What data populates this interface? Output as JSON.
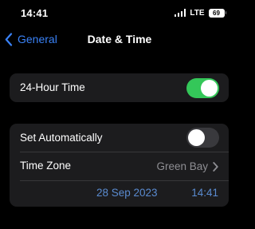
{
  "status_bar": {
    "time": "14:41",
    "network": "LTE",
    "battery_level": "69",
    "icons": [
      "signal-icon",
      "battery-icon"
    ]
  },
  "nav": {
    "back_label": "General",
    "title": "Date & Time",
    "back_icon": "chevron-left-icon"
  },
  "colors": {
    "accent": "#3a82f7",
    "toggle_on": "#34c759",
    "toggle_off": "#39393d",
    "group_bg": "#1c1c1e",
    "secondary_text": "#8e8e93",
    "date_time_text": "#5a8bd0"
  },
  "settings": {
    "hour24": {
      "label": "24-Hour Time",
      "enabled": true
    },
    "set_automatically": {
      "label": "Set Automatically",
      "enabled": false
    },
    "time_zone": {
      "label": "Time Zone",
      "value": "Green Bay",
      "icon": "chevron-right-icon"
    },
    "date": "28 Sep 2023",
    "time": "14:41"
  }
}
